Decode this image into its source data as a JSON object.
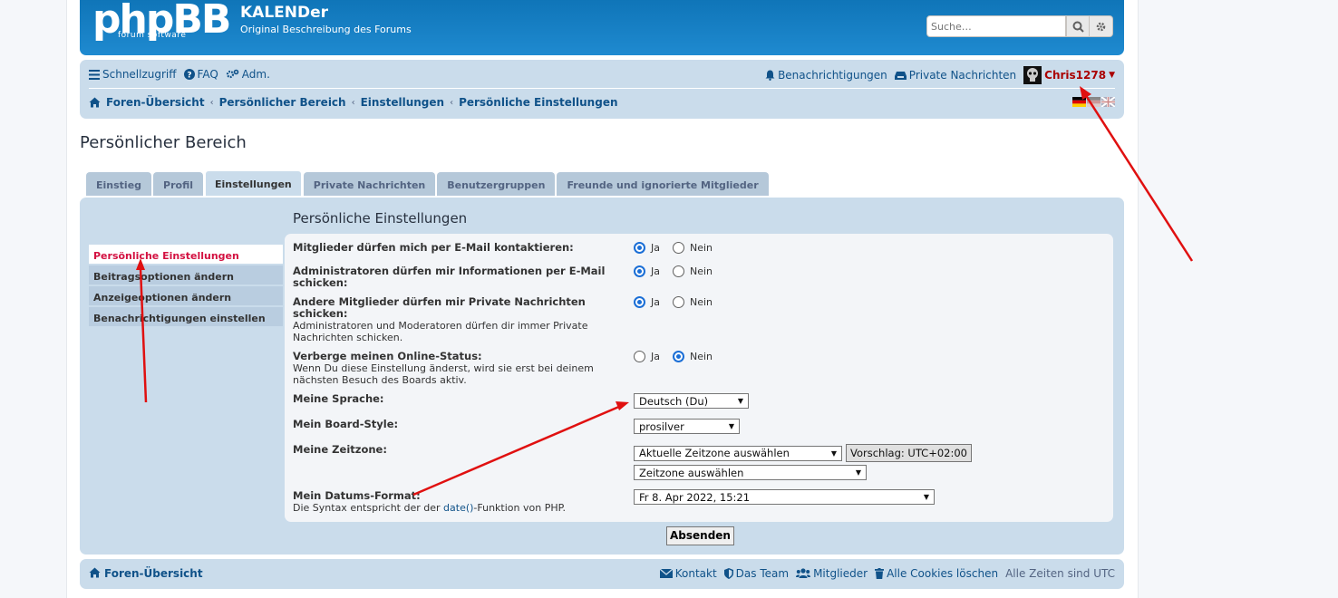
{
  "header": {
    "logo_text": "phpBB",
    "logo_subtitle": "forum software",
    "site_title": "KALENDer",
    "site_description": "Original Beschreibung des Forums",
    "search_placeholder": "Suche…"
  },
  "navbar": {
    "quick_links": "Schnellzugriff",
    "faq": "FAQ",
    "acp": "Adm.",
    "notifications": "Benachrichtigungen",
    "private_messages": "Private Nachrichten",
    "username": "Chris1278"
  },
  "breadcrumbs": [
    "Foren-Übersicht",
    "Persönlicher Bereich",
    "Einstellungen",
    "Persönliche Einstellungen"
  ],
  "page_title": "Persönlicher Bereich",
  "tabs": [
    "Einstieg",
    "Profil",
    "Einstellungen",
    "Private Nachrichten",
    "Benutzergruppen",
    "Freunde und ignorierte Mitglieder"
  ],
  "active_tab": "Einstellungen",
  "sidebar": [
    "Persönliche Einstellungen",
    "Beitragsoptionen ändern",
    "Anzeigeoptionen ändern",
    "Benachrichtigungen einstellen"
  ],
  "panel_title": "Persönliche Einstellungen",
  "form": {
    "yes": "Ja",
    "no": "Nein",
    "rows": [
      {
        "label": "Mitglieder dürfen mich per E-Mail kontaktieren:",
        "explain": "",
        "value": "Ja"
      },
      {
        "label": "Administratoren dürfen mir Informationen per E-Mail schicken:",
        "explain": "",
        "value": "Ja"
      },
      {
        "label": "Andere Mitglieder dürfen mir Private Nachrichten schicken:",
        "explain": "Administratoren und Moderatoren dürfen dir immer Private Nachrichten schicken.",
        "value": "Ja"
      },
      {
        "label": "Verberge meinen Online-Status:",
        "explain": "Wenn Du diese Einstellung änderst, wird sie erst bei deinem nächsten Besuch des Boards aktiv.",
        "value": "Nein"
      }
    ],
    "language_label": "Meine Sprache:",
    "language_value": "Deutsch (Du)",
    "style_label": "Mein Board-Style:",
    "style_value": "prosilver",
    "timezone_label": "Meine Zeitzone:",
    "timezone_select": "Aktuelle Zeitzone auswählen",
    "timezone_suggest": "Vorschlag: UTC+02:00",
    "timezone_zone": "Zeitzone auswählen",
    "dateformat_label": "Mein Datums-Format:",
    "dateformat_explain_before": "Die Syntax entspricht der der ",
    "dateformat_explain_link": "date()",
    "dateformat_explain_after": "-Funktion von PHP.",
    "dateformat_value": "Fr 8. Apr 2022, 15:21",
    "submit": "Absenden"
  },
  "footer": {
    "home": "Foren-Übersicht",
    "contact": "Kontakt",
    "team": "Das Team",
    "members": "Mitglieder",
    "delete_cookies": "Alle Cookies löschen",
    "timezone_note": "Alle Zeiten sind UTC"
  },
  "colors": {
    "header_blue": "#1279bd",
    "navbar_bg": "#cadceb",
    "link": "#105289",
    "username": "#aa0000",
    "sidebar_active": "#d31141",
    "annotation_arrow": "#e01010"
  }
}
